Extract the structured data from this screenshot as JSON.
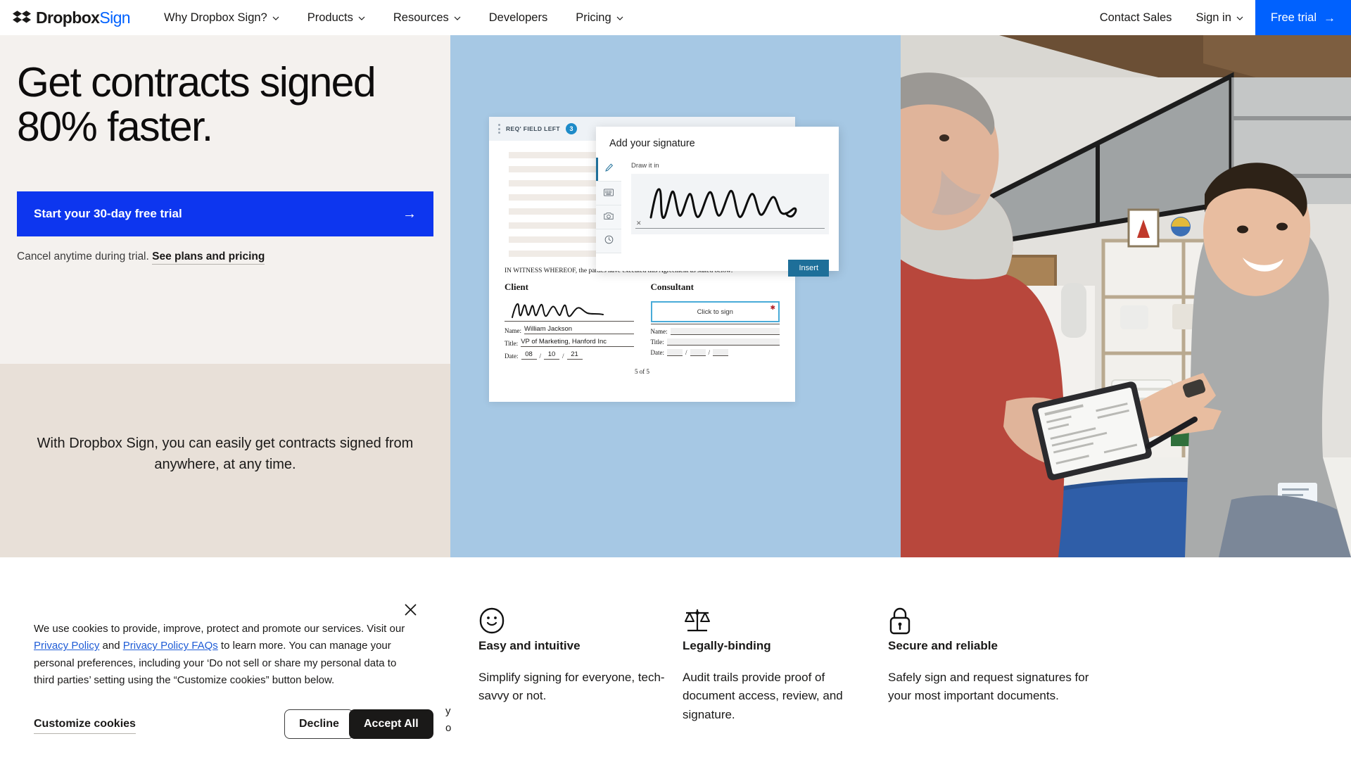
{
  "header": {
    "logo": {
      "brand": "Dropbox",
      "product": "Sign",
      "icon": "dropbox-logo-icon"
    },
    "nav": [
      {
        "label": "Why Dropbox Sign?",
        "has_caret": true
      },
      {
        "label": "Products",
        "has_caret": true
      },
      {
        "label": "Resources",
        "has_caret": true
      },
      {
        "label": "Developers",
        "has_caret": false
      },
      {
        "label": "Pricing",
        "has_caret": true
      }
    ],
    "contact_sales": "Contact Sales",
    "sign_in": "Sign in",
    "free_trial": "Free trial",
    "free_trial_arrow": "→",
    "accent_color": "#0061fe"
  },
  "hero": {
    "headline": "Get contracts signed 80% faster.",
    "cta_label": "Start your 30-day free trial",
    "cta_arrow": "→",
    "cta_color": "#0d36ef",
    "cancel_text": "Cancel anytime during trial.",
    "plans_link": "See plans and pricing",
    "tagline": "With Dropbox Sign, you can easily get contracts signed from anywhere, at any time.",
    "bg_top": "#f4f1ee",
    "bg_bottom": "#e8e0d8",
    "panel_color": "#a6c8e4"
  },
  "document": {
    "toolbar_label": "REQ' FIELD LEFT",
    "toolbar_badge": "3",
    "witness_line": "IN WITNESS WHEREOF, the parties have executed this Agreement as stated below:",
    "client": {
      "heading": "Client",
      "name_key": "Name:",
      "name_value": "William Jackson",
      "title_key": "Title:",
      "title_value": "VP of Marketing, Hanford Inc",
      "date_key": "Date:",
      "date_mm": "08",
      "date_dd": "10",
      "date_yy": "21"
    },
    "consultant": {
      "heading": "Consultant",
      "click_to_sign": "Click to sign",
      "required_marker": "✱",
      "name_key": "Name:",
      "title_key": "Title:",
      "date_key": "Date:"
    },
    "page_indicator": "5 of 5"
  },
  "signature_modal": {
    "title": "Add your signature",
    "draw_label": "Draw it in",
    "clear_marker": "✕",
    "insert_label": "Insert",
    "insert_color": "#1e6f99",
    "tabs": [
      {
        "icon": "pen-icon",
        "active": true
      },
      {
        "icon": "keyboard-icon",
        "active": false
      },
      {
        "icon": "camera-icon",
        "active": false
      },
      {
        "icon": "clock-icon",
        "active": false
      }
    ]
  },
  "features": [
    {
      "icon": "smiley-face-icon",
      "title": "Easy and intuitive",
      "body": "Simplify signing for everyone, tech-savvy or not."
    },
    {
      "icon": "scales-of-justice-icon",
      "title": "Legally-binding",
      "body": "Audit trails provide proof of document access, review, and signature."
    },
    {
      "icon": "padlock-icon",
      "title": "Secure and reliable",
      "body": "Safely sign and request signatures for your most important documents."
    }
  ],
  "cookie_banner": {
    "close_icon": "close-icon",
    "text_part1": "We use cookies to provide, improve, protect and promote our services. Visit our ",
    "link_privacy": "Privacy Policy",
    "text_and": " and ",
    "link_faqs": "Privacy Policy FAQs",
    "text_part2": " to learn more. You can manage your personal preferences, including your ‘Do not sell or share my personal data to third parties’ setting using the “Customize cookies” button below.",
    "customize_label": "Customize cookies",
    "decline_label": "Decline",
    "accept_label": "Accept All",
    "occluded_fragment_1": "y",
    "occluded_fragment_2": "o",
    "occluded_fragment_3": "-"
  }
}
